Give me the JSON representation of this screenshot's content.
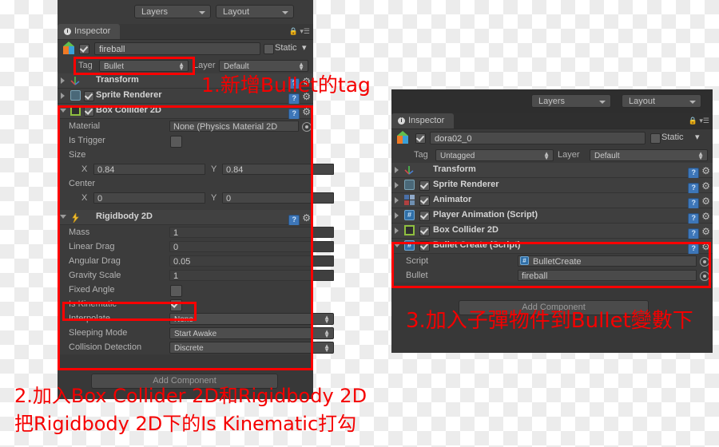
{
  "background": {
    "type": "transparency-checkerboard",
    "light": "#ffffff",
    "dark": "#ececec"
  },
  "left_panel": {
    "toolbar": {
      "layers_label": "Layers",
      "layout_label": "Layout"
    },
    "tab": {
      "label": "Inspector",
      "icon": "info-icon"
    },
    "object": {
      "name": "fireball",
      "enabled_checkbox": true,
      "static_label": "Static"
    },
    "tag_row": {
      "tag_label": "Tag",
      "tag_value": "Bullet",
      "layer_label": "Layer",
      "layer_value": "Default"
    },
    "components": [
      {
        "name": "Transform",
        "icon": "transform-axis-icon",
        "has_checkbox": false,
        "expanded": false
      },
      {
        "name": "Sprite Renderer",
        "icon": "sprite-renderer-icon",
        "has_checkbox": true,
        "checked": true,
        "expanded": false
      },
      {
        "name": "Box Collider 2D",
        "icon": "box-collider-2d-icon",
        "has_checkbox": true,
        "checked": true,
        "expanded": true
      },
      {
        "name": "Rigidbody 2D",
        "icon": "rigidbody-2d-icon",
        "has_checkbox": false,
        "expanded": true
      }
    ],
    "box_collider_props": [
      {
        "label": "Material",
        "value": "None (Physics Material 2D",
        "kind": "object"
      },
      {
        "label": "Is Trigger",
        "value": "",
        "kind": "checkbox",
        "checked": false
      },
      {
        "label": "Size",
        "value": "",
        "kind": "header"
      },
      {
        "label": "X",
        "value": "0.84",
        "label2": "Y",
        "value2": "0.84",
        "kind": "vector2"
      },
      {
        "label": "Center",
        "value": "",
        "kind": "header"
      },
      {
        "label": "X",
        "value": "0",
        "label2": "Y",
        "value2": "0",
        "kind": "vector2"
      }
    ],
    "rigidbody_props": [
      {
        "label": "Mass",
        "value": "1",
        "kind": "field"
      },
      {
        "label": "Linear Drag",
        "value": "0",
        "kind": "field"
      },
      {
        "label": "Angular Drag",
        "value": "0.05",
        "kind": "field"
      },
      {
        "label": "Gravity Scale",
        "value": "1",
        "kind": "field"
      },
      {
        "label": "Fixed Angle",
        "value": "",
        "kind": "checkbox",
        "checked": false
      },
      {
        "label": "Is Kinematic",
        "value": "",
        "kind": "checkbox",
        "checked": true
      },
      {
        "label": "Interpolate",
        "value": "None",
        "kind": "popup"
      },
      {
        "label": "Sleeping Mode",
        "value": "Start Awake",
        "kind": "popup"
      },
      {
        "label": "Collision Detection",
        "value": "Discrete",
        "kind": "popup"
      }
    ],
    "add_component_label": "Add Component"
  },
  "right_panel": {
    "toolbar": {
      "layers_label": "Layers",
      "layout_label": "Layout"
    },
    "tab": {
      "label": "Inspector",
      "icon": "info-icon"
    },
    "object": {
      "name": "dora02_0",
      "enabled_checkbox": true,
      "static_label": "Static"
    },
    "tag_row": {
      "tag_label": "Tag",
      "tag_value": "Untagged",
      "layer_label": "Layer",
      "layer_value": "Default"
    },
    "components": [
      {
        "name": "Transform",
        "icon": "transform-axis-icon",
        "has_checkbox": false,
        "expanded": false
      },
      {
        "name": "Sprite Renderer",
        "icon": "sprite-renderer-icon",
        "has_checkbox": true,
        "checked": true,
        "expanded": false
      },
      {
        "name": "Animator",
        "icon": "animator-icon",
        "has_checkbox": true,
        "checked": true,
        "expanded": false
      },
      {
        "name": "Player Animation (Script)",
        "icon": "script-icon",
        "has_checkbox": true,
        "checked": true,
        "expanded": false
      },
      {
        "name": "Box Collider 2D",
        "icon": "box-collider-2d-icon",
        "has_checkbox": true,
        "checked": true,
        "expanded": false
      },
      {
        "name": "Bullet Create (Script)",
        "icon": "script-icon",
        "has_checkbox": true,
        "checked": true,
        "expanded": true
      }
    ],
    "bullet_create_props": [
      {
        "label": "Script",
        "value": "BulletCreate",
        "has_script_icon": true
      },
      {
        "label": "Bullet",
        "value": "fireball",
        "has_script_icon": false
      }
    ],
    "add_component_label": "Add Component"
  },
  "annotations": {
    "color": "#f50000",
    "note1": "1.新增Bullet的tag",
    "note2_line1": "2.加入Box Collider 2D和Rigidbody 2D",
    "note2_line2": "把Rigidbody 2D下的Is Kinematic打勾",
    "note3": "3.加入子彈物件到Bullet變數下"
  }
}
